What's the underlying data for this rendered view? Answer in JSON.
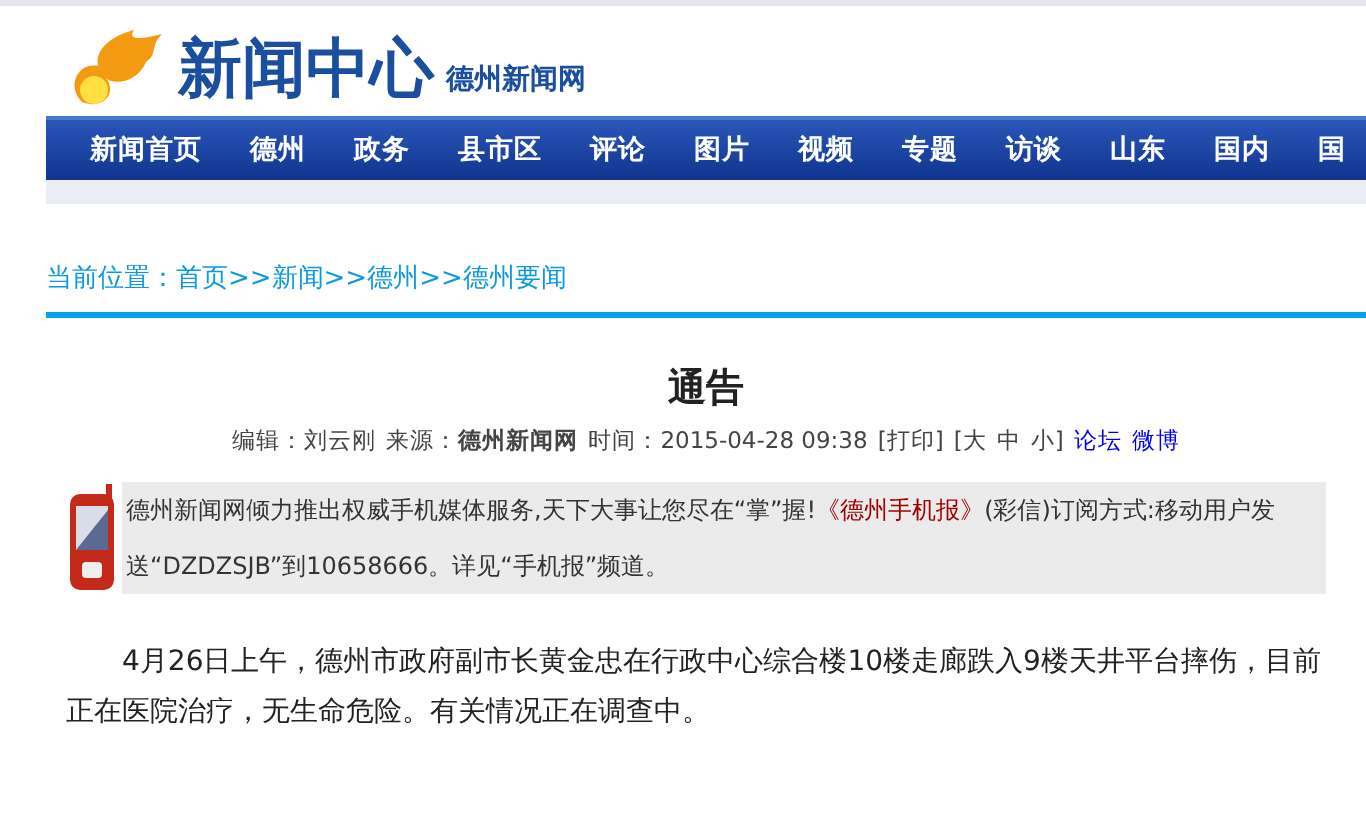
{
  "header": {
    "title": "新闻中心",
    "subtitle": "德州新闻网"
  },
  "nav": {
    "items": [
      "新闻首页",
      "德州",
      "政务",
      "县市区",
      "评论",
      "图片",
      "视频",
      "专题",
      "访谈",
      "山东",
      "国内",
      "国"
    ]
  },
  "breadcrumb": {
    "label": "当前位置：",
    "path": "首页>>新闻>>德州>>德州要闻"
  },
  "article": {
    "title": "通告",
    "meta": [
      {
        "kind": "text",
        "text": "编辑：刘云刚"
      },
      {
        "kind": "text",
        "text": "来源：**德州新闻网**"
      },
      {
        "kind": "text",
        "text": "时间：2015-04-28 09:38"
      },
      {
        "kind": "control",
        "text": "[打印]"
      },
      {
        "kind": "control",
        "text": "[大"
      },
      {
        "kind": "control",
        "text": "中"
      },
      {
        "kind": "control",
        "text": "小]"
      },
      {
        "kind": "link",
        "text": "论坛"
      },
      {
        "kind": "link",
        "text": "微博"
      }
    ],
    "notice": {
      "before": "德州新闻网倾力推出权威手机媒体服务,天下大事让您尽在“掌”握!",
      "link": "《德州手机报》",
      "after": "(彩信)订阅方式:移动用户发送“DZDZSJB”到10658666。详见“手机报”频道。"
    },
    "body": "4月26日上午，德州市政府副市长黄金忠在行政中心综合楼10楼走廊跌入9楼天井平台摔伤，目前正在医院治疗，无生命危险。有关情况正在调查中。"
  }
}
